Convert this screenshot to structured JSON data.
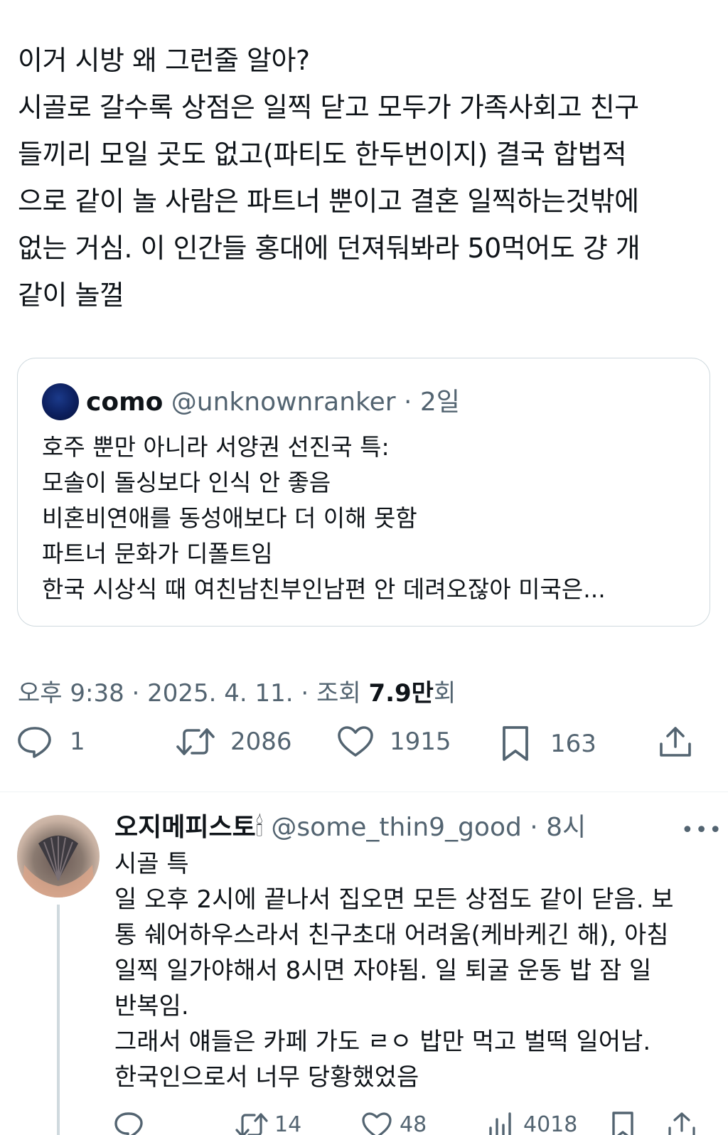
{
  "tweet": {
    "lines": [
      "이거 시방 왜 그런줄 알아?",
      "시골로 갈수록 상점은 일찍 닫고 모두가 가족사회고 친구",
      "들끼리 모일 곳도 없고(파티도 한두번이지) 결국 합법적",
      "으로 같이 놀 사람은 파트너 뿐이고 결혼 일찍하는것밖에",
      "없는 거심. 이 인간들 홍대에 던져둬봐라 50먹어도 걍 개",
      "같이 놀껄"
    ],
    "meta": {
      "time": "오후 9:38",
      "sep1": " · ",
      "date": "2025. 4. 11.",
      "sep2": " · ",
      "views_prefix": "조회 ",
      "views": "7.9만",
      "views_suffix": "회"
    },
    "actions": {
      "replies": "1",
      "retweets": "2086",
      "likes": "1915",
      "bookmarks": "163"
    }
  },
  "quoted": {
    "name": "como",
    "handle": "@unknownranker",
    "dot": " · ",
    "time": "2일",
    "lines": [
      "호주 뿐만 아니라 서양권 선진국 특:",
      "모솔이 돌싱보다 인식 안 좋음",
      "비혼비연애를 동성애보다 더 이해 못함",
      "파트너 문화가 디폴트임",
      "한국 시상식 때 여친남친부인남편 안 데려오잖아 미국은..."
    ]
  },
  "reply": {
    "name": "오지메피스토",
    "name_emoji": "🕯",
    "handle": "@some_thin9_good",
    "dot": " · ",
    "time": "8시",
    "more": "•••",
    "lines": [
      "시골 특",
      "일 오후 2시에 끝나서 집오면 모든 상점도 같이 닫음. 보",
      "통 쉐어하우스라서 친구초대 어려움(케바케긴 해), 아침",
      "일찍 일가야해서 8시면 자야됨. 일 퇴굴 운동 밥 잠 일",
      "반복임.",
      "그래서 얘들은 카페 가도 ㄹㅇ 밥만 먹고 벌떡 일어남.",
      "한국인으로서 너무 당황했었음"
    ],
    "actions": {
      "retweets": "14",
      "likes": "48",
      "views": "4018"
    }
  }
}
